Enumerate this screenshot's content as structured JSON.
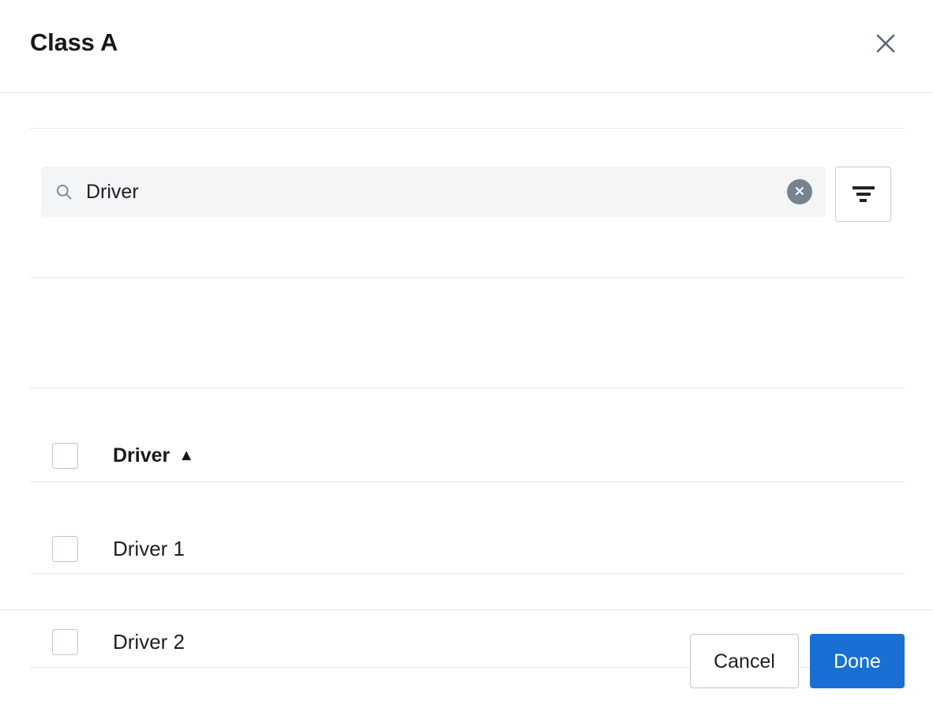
{
  "dialog": {
    "title": "Class A",
    "close_icon": "close-icon",
    "close_label": "Close"
  },
  "search": {
    "icon": "search-icon",
    "value": "Driver",
    "placeholder": "Search",
    "clear_icon": "clear-icon",
    "filter_icon": "filter-icon",
    "filter_label": "Filter"
  },
  "list": {
    "header": {
      "label": "Driver",
      "sort_arrow": "▲",
      "sort_direction": "ascending"
    },
    "rows": [
      {
        "label": "Driver 1",
        "checked": false
      },
      {
        "label": "Driver 2",
        "checked": false
      }
    ]
  },
  "footer": {
    "cancel_label": "Cancel",
    "done_label": "Done"
  },
  "colors": {
    "primary": "#1a6fd4",
    "border": "#e3e7ec",
    "checkbox_border": "#bac5d0",
    "search_bg": "#f3f5f7",
    "clear_bg": "#78838f",
    "text": "#1d1f22"
  }
}
